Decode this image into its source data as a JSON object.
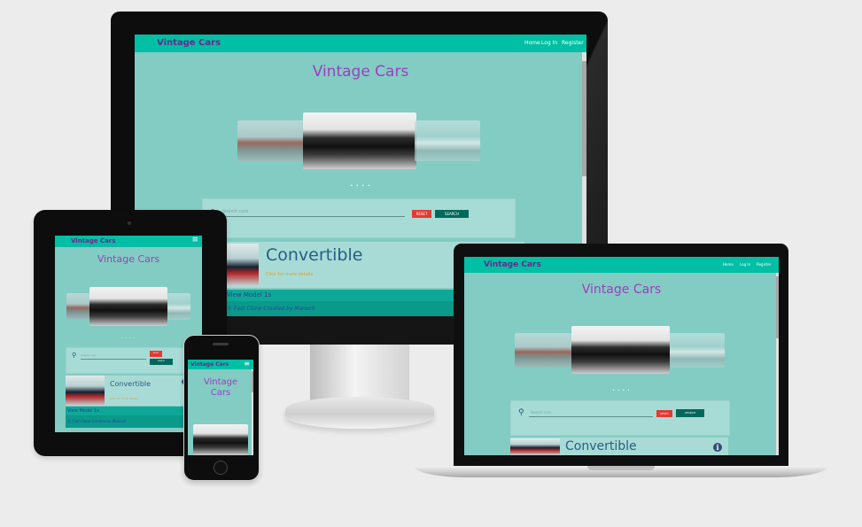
{
  "site": {
    "brand": "Vintage Cars",
    "title": "Vintage Cars",
    "nav": [
      "Home",
      "Log In",
      "Register"
    ],
    "hamburger": "≡",
    "dots": "• • • •",
    "search_placeholder": "Search cars",
    "reset_label": "RESET",
    "search_label": "SEARCH",
    "card_title": "Convertible",
    "card_subtitle": "Click for more details",
    "model_label": "View Model 1s",
    "footer_text": "© Fast Clone Created by Manoch"
  },
  "colors": {
    "navbar": "#00bfa5",
    "page_bg": "#83ccc3",
    "title": "#9c3fc0",
    "reset_button": "#e53935",
    "search_button": "#00695c"
  }
}
